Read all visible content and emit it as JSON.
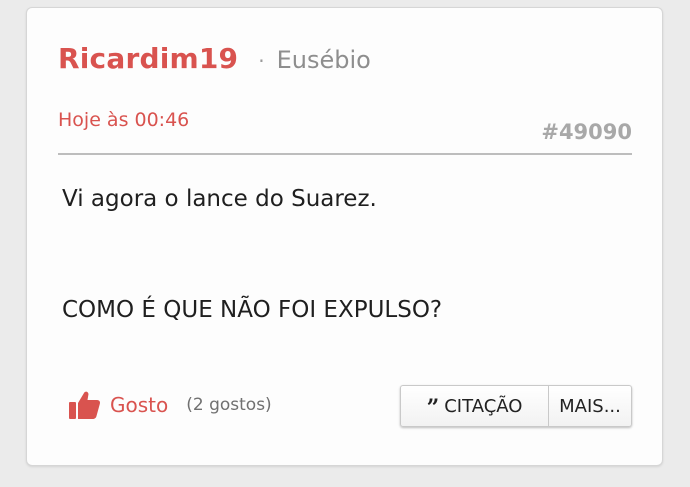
{
  "post": {
    "author": "Ricardim19",
    "separator": "·",
    "rank": "Eusébio",
    "timestamp": "Hoje às 00:46",
    "post_number": "#49090",
    "body": {
      "line1": "Vi agora o lance do Suarez.",
      "line2": "COMO É QUE NÃO FOI EXPULSO?"
    }
  },
  "actions": {
    "like_label": "Gosto",
    "like_count": "(2 gostos)",
    "quote_label": "CITAÇÃO",
    "more_label": "MAIS..."
  },
  "icons": {
    "like": "thumbs-up-icon",
    "quote": "quote-icon"
  },
  "colors": {
    "accent": "#d9534f",
    "muted": "#8e8e8e",
    "text": "#1f1f1f"
  }
}
